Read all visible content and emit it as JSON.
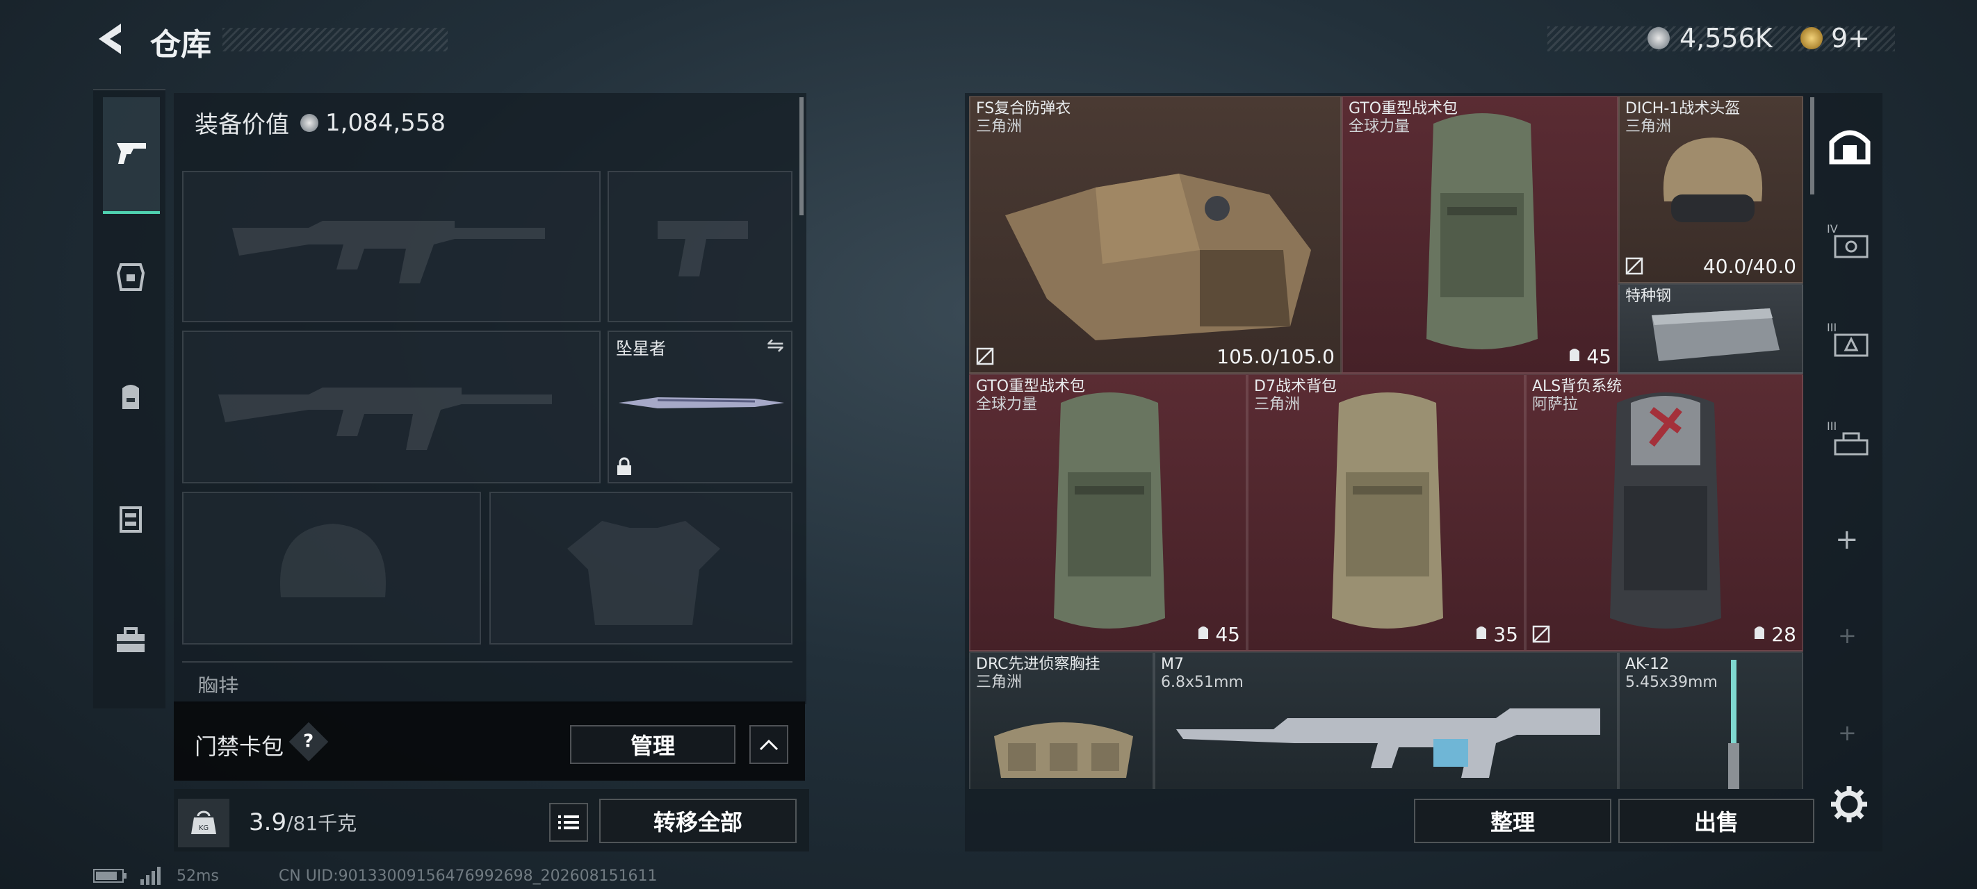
{
  "header": {
    "title": "仓库",
    "currency_value": "4,556K",
    "gold_value": "9+"
  },
  "left": {
    "equip_value_label": "装备价值",
    "equip_value": "1,084,558",
    "melee_label": "坠星者",
    "chest_section_label": "胸挂",
    "access_card": {
      "label": "门禁卡包",
      "help": "?",
      "manage": "管理"
    },
    "weight_value": "3.9",
    "weight_unit": "/81千克",
    "transfer_all": "转移全部"
  },
  "items": {
    "vest": {
      "name": "FS复合防弹衣",
      "sub": "三角洲",
      "value": "105.0/105.0"
    },
    "gto1": {
      "name": "GTO重型战术包",
      "sub": "全球力量",
      "value": "45"
    },
    "helmet": {
      "name": "DICH-1战术头盔",
      "sub": "三角洲",
      "value": "40.0/40.0"
    },
    "steel": {
      "name": "特种钢"
    },
    "gto2": {
      "name": "GTO重型战术包",
      "sub": "全球力量",
      "value": "45"
    },
    "d7": {
      "name": "D7战术背包",
      "sub": "三角洲",
      "value": "35"
    },
    "als": {
      "name": "ALS背负系统",
      "sub": "阿萨拉",
      "value": "28"
    },
    "drc": {
      "name": "DRC先进侦察胸挂",
      "sub": "三角洲"
    },
    "m7": {
      "name": "M7",
      "sub": "6.8x51mm"
    },
    "ak12": {
      "name": "AK-12",
      "sub": "5.45x39mm"
    }
  },
  "right_sidebar": {
    "tiers": [
      "IV",
      "III",
      "III"
    ]
  },
  "actions": {
    "organize": "整理",
    "sell": "出售"
  },
  "footer": {
    "ping": "52ms",
    "uid": "CN UID:90133009156476992698_202608151611"
  }
}
